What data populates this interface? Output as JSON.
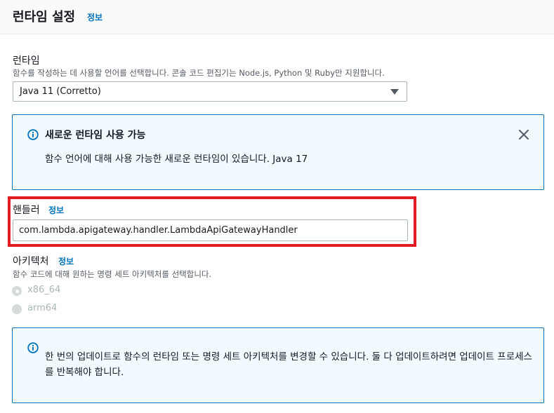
{
  "header": {
    "title": "런타임 설정",
    "info_link": "정보"
  },
  "runtime": {
    "label": "런타임",
    "description": "함수를 작성하는 데 사용할 언어를 선택합니다. 콘솔 코드 편집기는 Node.js, Python 및 Ruby만 지원합니다.",
    "selected": "Java 11 (Corretto)"
  },
  "runtime_alert": {
    "title": "새로운 런타임 사용 가능",
    "body": "함수 언어에 대해 사용 가능한 새로운 런타임이 있습니다. Java 17"
  },
  "handler": {
    "label": "핸들러",
    "info_link": "정보",
    "value": "com.lambda.apigateway.handler.LambdaApiGatewayHandler"
  },
  "architecture": {
    "label": "아키텍처",
    "info_link": "정보",
    "description": "함수 코드에 대해 원하는 명령 세트 아키텍처를 선택합니다.",
    "options": [
      {
        "label": "x86_64",
        "selected": true
      },
      {
        "label": "arm64",
        "selected": false
      }
    ]
  },
  "architecture_alert": {
    "body": "한 번의 업데이트로 함수의 런타임 또는 명령 세트 아키텍처를 변경할 수 있습니다. 둘 다 업데이트하려면 업데이트 프로세스를 반복해야 합니다."
  },
  "colors": {
    "link": "#0073bb",
    "highlight": "#e31b23",
    "alert_border": "#0073bb",
    "alert_bg": "#f1faff"
  }
}
